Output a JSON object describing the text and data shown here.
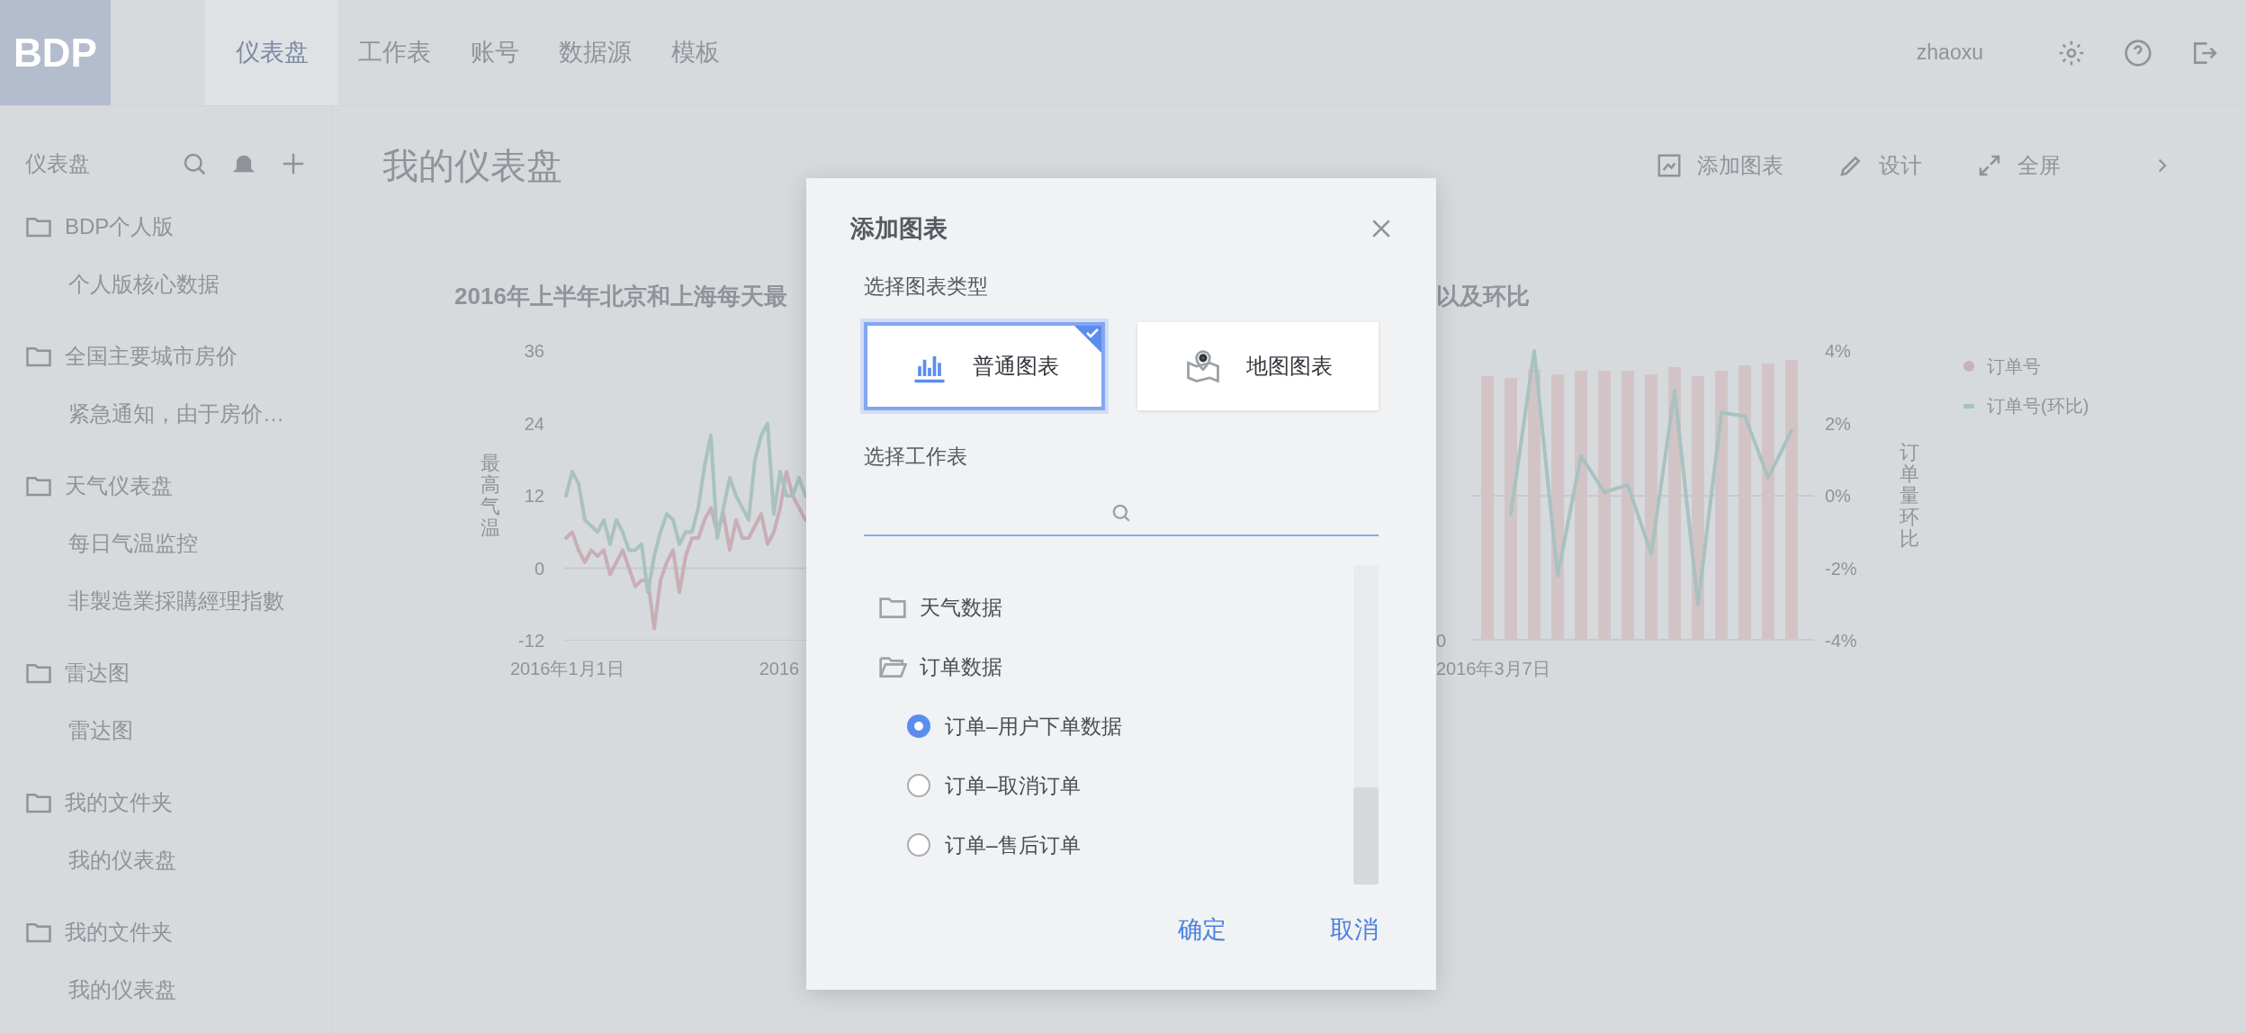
{
  "header": {
    "logo": "BDP",
    "nav": [
      {
        "label": "仪表盘",
        "selected": true
      },
      {
        "label": "工作表",
        "selected": false
      },
      {
        "label": "账号",
        "selected": false
      },
      {
        "label": "数据源",
        "selected": false
      },
      {
        "label": "模板",
        "selected": false
      }
    ],
    "user": "zhaoxu"
  },
  "sidebar": {
    "title": "仪表盘",
    "groups": [
      {
        "label": "BDP个人版",
        "children": [
          {
            "label": "个人版核心数据"
          }
        ]
      },
      {
        "label": "全国主要城市房价",
        "children": [
          {
            "label": "紧急通知，由于房价…"
          }
        ]
      },
      {
        "label": "天气仪表盘",
        "children": [
          {
            "label": "每日气温监控"
          },
          {
            "label": "非製造業採購經理指數"
          }
        ]
      },
      {
        "label": "雷达图",
        "children": [
          {
            "label": "雷达图"
          }
        ]
      },
      {
        "label": "我的文件夹",
        "children": [
          {
            "label": "我的仪表盘"
          }
        ]
      },
      {
        "label": "我的文件夹",
        "children": [
          {
            "label": "我的仪表盘"
          }
        ]
      }
    ]
  },
  "main": {
    "title": "我的仪表盘",
    "toolbar": [
      {
        "label": "添加图表",
        "kind": "add-chart"
      },
      {
        "label": "设计",
        "kind": "design"
      },
      {
        "label": "全屏",
        "kind": "fullscreen"
      }
    ],
    "charts": [
      {
        "title": "2016年上半年北京和上海每天最",
        "xlabels": [
          "2016年1月1日",
          "2016"
        ],
        "chart_data": {
          "type": "line",
          "ylabel": "最高气温",
          "yticks": [
            36,
            24,
            12,
            0,
            -12
          ],
          "ylim": [
            -12,
            36
          ],
          "series": [
            {
              "color": "#c9aeb5",
              "values": [
                5,
                6,
                3,
                1,
                3,
                2,
                3,
                -1,
                1,
                3,
                0,
                -3,
                -2,
                -2,
                -10,
                -2,
                1,
                3,
                -4,
                2,
                5,
                5,
                8,
                10,
                6,
                9,
                3,
                8,
                5,
                5,
                7,
                9,
                4,
                6,
                10,
                16,
                12,
                10,
                8
              ]
            },
            {
              "color": "#a9c2bf",
              "values": [
                12,
                16,
                14,
                8,
                7,
                6,
                8,
                4,
                8,
                6,
                3,
                3,
                4,
                -4,
                2,
                6,
                9,
                8,
                4,
                6,
                6,
                10,
                17,
                22,
                5,
                10,
                15,
                12,
                10,
                8,
                18,
                22,
                24,
                9,
                16,
                12,
                12,
                15,
                12
              ]
            }
          ]
        }
      },
      {
        "title": "以及环比",
        "left_ticks": [
          "0"
        ],
        "xlabels": [
          "2016年3月7日"
        ],
        "chart_data": {
          "type": "line",
          "ylabel": "订单量环比",
          "yticks": [
            {
              "value": 4,
              "label": "4%"
            },
            {
              "value": 2,
              "label": "2%"
            },
            {
              "value": 0,
              "label": "0%"
            },
            {
              "value": -2,
              "label": "-2%"
            },
            {
              "value": -4,
              "label": "-4%"
            }
          ],
          "ylim": [
            -4,
            4
          ],
          "series": [
            {
              "name": "订单号(环比)",
              "color": "#a9c2bf",
              "values": [
                -0.5,
                4.0,
                -2.2,
                1.1,
                0.1,
                0.3,
                -1.6,
                2.9,
                -3.0,
                2.3,
                2.2,
                0.5,
                1.8
              ]
            }
          ]
        },
        "legend": [
          {
            "label": "订单号",
            "kind": "dot"
          }
        ]
      }
    ]
  },
  "dialog": {
    "title": "添加图表",
    "type_label": "选择图表类型",
    "chart_types": [
      {
        "label": "普通图表",
        "kind": "bar",
        "selected": true
      },
      {
        "label": "地图图表",
        "kind": "map",
        "selected": false
      }
    ],
    "worksheet_label": "选择工作表",
    "worksheets": [
      {
        "label": "天气数据",
        "expanded": false
      },
      {
        "label": "订单数据",
        "expanded": true,
        "children": [
          {
            "label": "订单–用户下单数据",
            "selected": true
          },
          {
            "label": "订单–取消订单",
            "selected": false
          },
          {
            "label": "订单–售后订单",
            "selected": false
          }
        ]
      }
    ],
    "buttons": [
      "确定",
      "取消"
    ]
  }
}
